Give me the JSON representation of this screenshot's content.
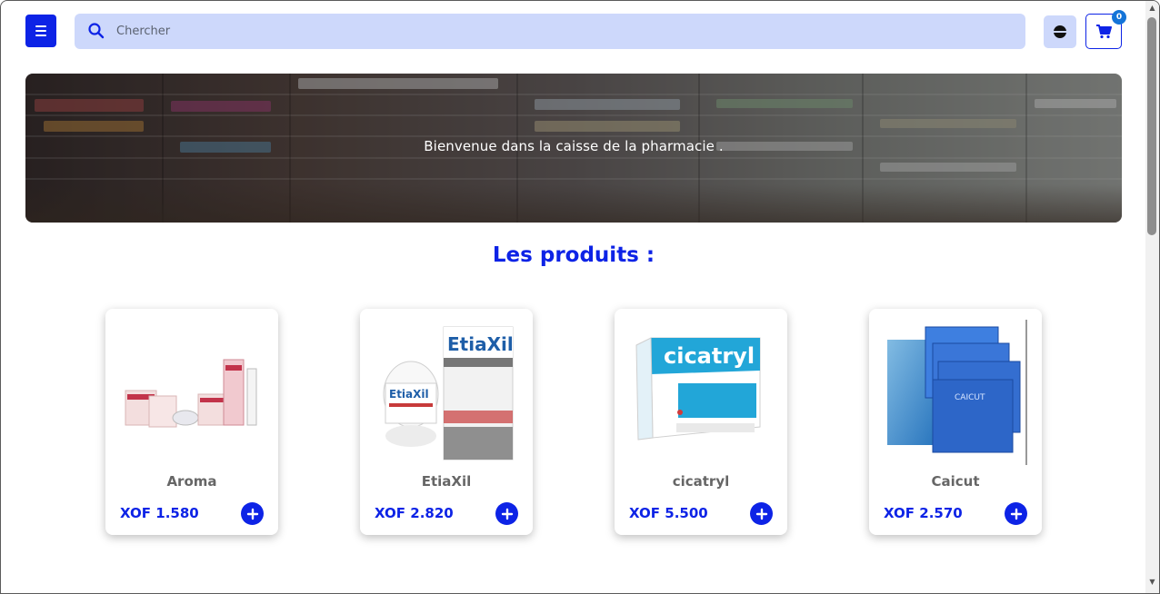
{
  "header": {
    "search_placeholder": "Chercher",
    "cart_count": "0"
  },
  "banner": {
    "text": "Bienvenue dans la caisse de la pharmacie ."
  },
  "section_title": "Les produits :",
  "products": [
    {
      "name": "Aroma",
      "price": "XOF 1.580"
    },
    {
      "name": "EtiaXil",
      "price": "XOF 2.820"
    },
    {
      "name": "cicatryl",
      "price": "XOF 5.500"
    },
    {
      "name": "Caicut",
      "price": "XOF 2.570"
    }
  ],
  "colors": {
    "accent": "#0d23e6",
    "search_bg": "#cdd8fb",
    "badge": "#1474d8"
  },
  "icons": {
    "menu": "hamburger-icon",
    "search": "search-icon",
    "theme": "theme-toggle-icon",
    "cart": "cart-icon",
    "add": "plus-icon"
  }
}
